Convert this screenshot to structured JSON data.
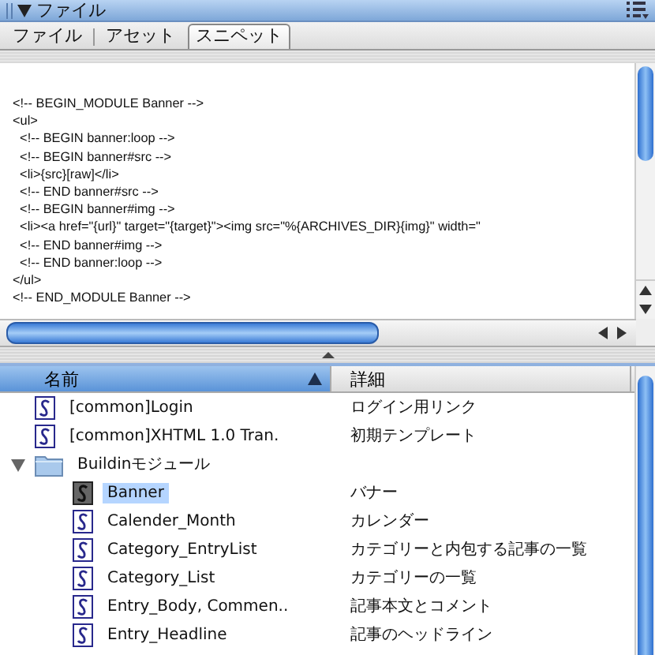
{
  "panel": {
    "title": "ファイル"
  },
  "tabs": [
    {
      "label": "ファイル",
      "selected": false
    },
    {
      "label": "アセット",
      "selected": false
    },
    {
      "label": "スニペット",
      "selected": true
    }
  ],
  "snippet": {
    "lines": [
      "<!-- BEGIN_MODULE Banner -->",
      "<ul>",
      "  <!-- BEGIN banner:loop -->",
      "  <!-- BEGIN banner#src -->",
      "  <li>{src}[raw]</li>",
      "  <!-- END banner#src -->",
      "  <!-- BEGIN banner#img -->",
      "  <li><a href=\"{url}\" target=\"{target}\"><img src=\"%{ARCHIVES_DIR}{img}\" width=\"",
      "  <!-- END banner#img -->",
      "  <!-- END banner:loop -->",
      "</ul>",
      "<!-- END_MODULE Banner -->"
    ]
  },
  "list": {
    "columns": [
      {
        "label": "名前",
        "sorted": true
      },
      {
        "label": "詳細",
        "sorted": false
      }
    ],
    "rows": [
      {
        "kind": "file",
        "name": "[common]Login",
        "detail": "ログイン用リンク",
        "selected": false
      },
      {
        "kind": "file",
        "name": "[common]XHTML 1.0 Tran.",
        "detail": "初期テンプレート",
        "selected": false
      },
      {
        "kind": "folder",
        "name": "Buildinモジュール",
        "selected": false,
        "expanded": true,
        "children": [
          {
            "kind": "file",
            "name": "Banner",
            "detail": "バナー",
            "selected": true
          },
          {
            "kind": "file",
            "name": "Calender_Month",
            "detail": "カレンダー",
            "selected": false
          },
          {
            "kind": "file",
            "name": "Category_EntryList",
            "detail": "カテゴリーと内包する記事の一覧",
            "selected": false
          },
          {
            "kind": "file",
            "name": "Category_List",
            "detail": "カテゴリーの一覧",
            "selected": false
          },
          {
            "kind": "file",
            "name": "Entry_Body, Commen..",
            "detail": "記事本文とコメント",
            "selected": false
          },
          {
            "kind": "file",
            "name": "Entry_Headline",
            "detail": "記事のヘッドライン",
            "selected": false
          }
        ]
      }
    ]
  }
}
